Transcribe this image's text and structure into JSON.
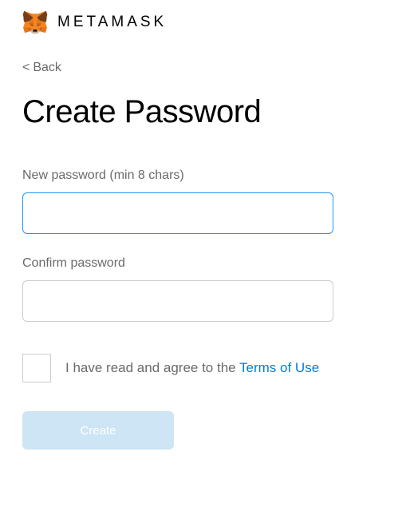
{
  "header": {
    "brand": "METAMASK"
  },
  "nav": {
    "back_label": "Back"
  },
  "page": {
    "title": "Create Password"
  },
  "form": {
    "new_password": {
      "label": "New password (min 8 chars)",
      "value": ""
    },
    "confirm_password": {
      "label": "Confirm password",
      "value": ""
    },
    "terms": {
      "prefix": "I have read and agree to the ",
      "link_text": "Terms of Use",
      "checked": false
    },
    "submit_label": "Create"
  }
}
